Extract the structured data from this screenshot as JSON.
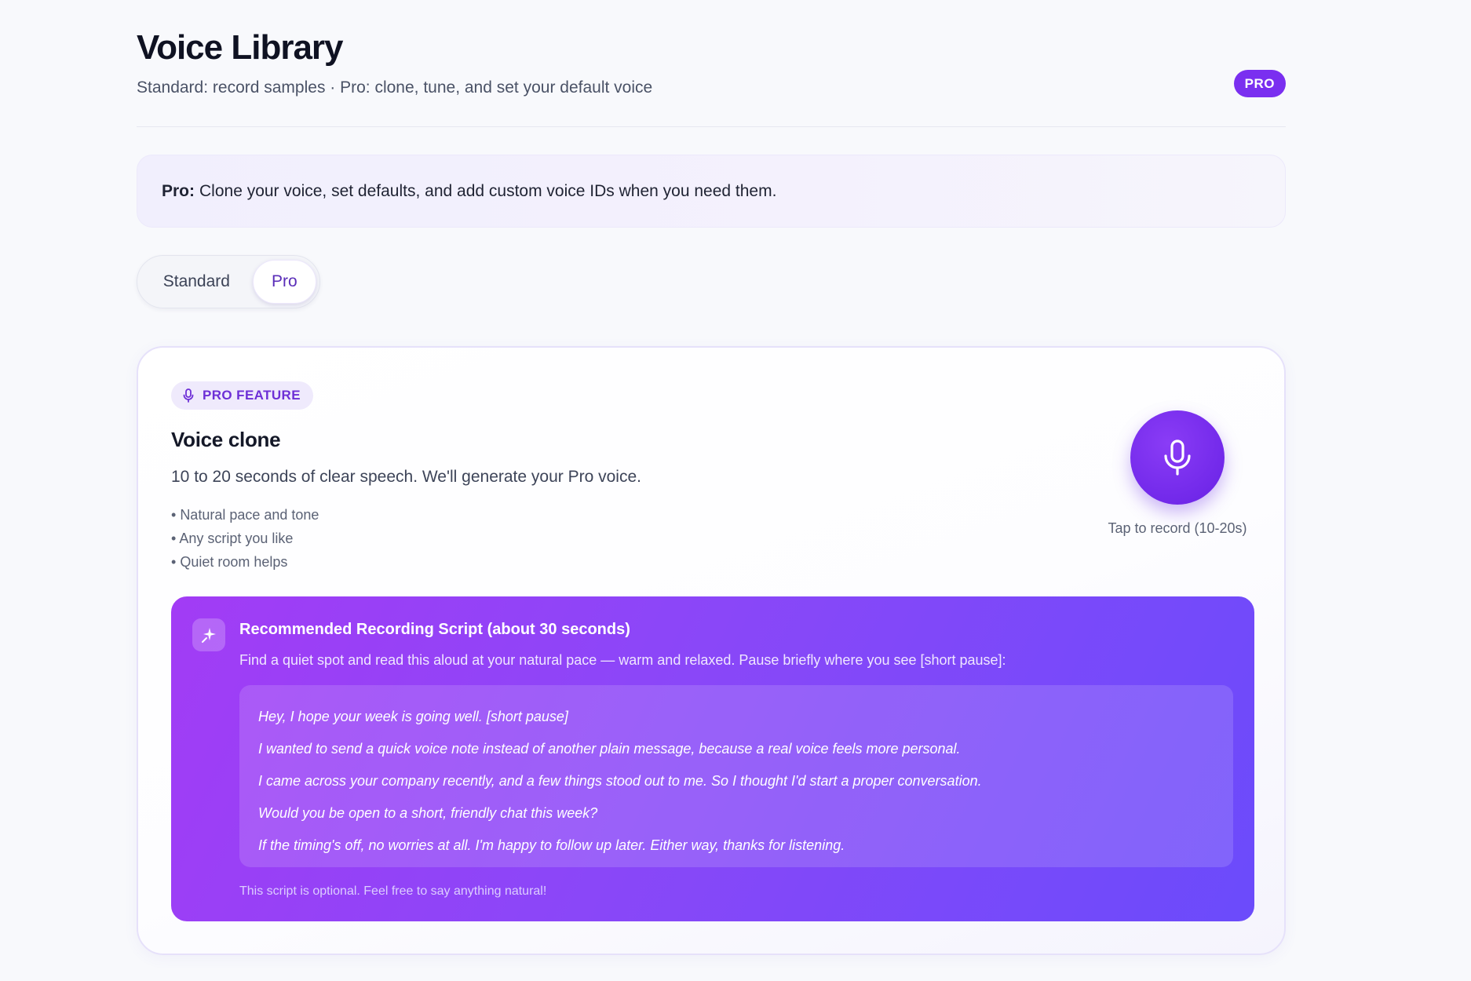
{
  "header": {
    "title": "Voice Library",
    "subtitle": "Standard: record samples · Pro: clone, tune, and set your default voice",
    "badge": "PRO"
  },
  "banner": {
    "lead": "Pro:",
    "text": "Clone your voice, set defaults, and add custom voice IDs when you need them."
  },
  "toggle": {
    "options": [
      "Standard",
      "Pro"
    ],
    "selected": "Pro"
  },
  "clone_card": {
    "badge_icon": "microphone-icon",
    "badge": "PRO FEATURE",
    "title": "Voice clone",
    "description": "10 to 20 seconds of clear speech. We'll generate your Pro voice.",
    "tips": [
      "Natural pace and tone",
      "Any script you like",
      "Quiet room helps"
    ],
    "record_icon": "microphone-icon",
    "record_caption": "Tap to record (10-20s)",
    "accent_color": "#7229ea"
  },
  "script": {
    "icon": "sparkle-icon",
    "title": "Recommended Recording Script (about 30 seconds)",
    "subtitle": "Find a quiet spot and read this aloud at your natural pace — warm and relaxed. Pause briefly where you see [short pause]:",
    "lines": [
      "Hey, I hope your week is going well. [short pause]",
      "I wanted to send a quick voice note instead of another plain message, because a real voice feels more personal.",
      "I came across your company recently, and a few things stood out to me. So I thought I'd start a proper conversation.",
      "Would you be open to a short, friendly chat this week?",
      "If the timing's off, no worries at all. I'm happy to follow up later. Either way, thanks for listening."
    ],
    "note": "This script is optional. Feel free to say anything natural!",
    "gradient": [
      "#a23cf5",
      "#6b4bfb"
    ]
  }
}
